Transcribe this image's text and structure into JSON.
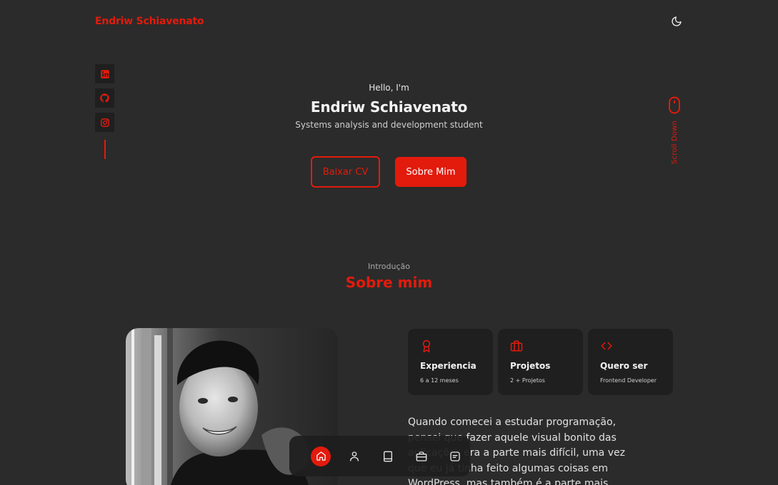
{
  "header": {
    "brand": "Endriw Schiavenato",
    "theme_icon": "moon-icon"
  },
  "social": {
    "items": [
      {
        "icon": "linkedin-icon"
      },
      {
        "icon": "github-icon"
      },
      {
        "icon": "instagram-icon"
      }
    ]
  },
  "hero": {
    "greeting": "Hello, I'm",
    "name": "Endriw Schiavenato",
    "subtitle": "Systems analysis and development student",
    "download_cv_label": "Baixar CV",
    "about_me_label": "Sobre Mim"
  },
  "scroll": {
    "label": "Scroll Down",
    "icon": "mouse-icon"
  },
  "about": {
    "subtitle": "Introdução",
    "title": "Sobre mim",
    "cards": [
      {
        "icon": "award-icon",
        "title": "Experiencia",
        "subtitle": "6 a 12 meses"
      },
      {
        "icon": "briefcase-icon",
        "title": "Projetos",
        "subtitle": "2 + Projetos"
      },
      {
        "icon": "code-icon",
        "title": "Quero ser",
        "subtitle": "Frontend Developer"
      }
    ],
    "text": "Quando comecei a estudar programação, pensei que fazer aquele visual bonito das aplicações era a parte mais difícil, uma vez que eu já tinha feito algumas coisas em WordPress, mas também é a parte mais prazerosa e que"
  },
  "bottom_nav": {
    "items": [
      {
        "icon": "home-icon",
        "active": true
      },
      {
        "icon": "user-icon",
        "active": false
      },
      {
        "icon": "book-icon",
        "active": false
      },
      {
        "icon": "briefcase-icon",
        "active": false
      },
      {
        "icon": "message-icon",
        "active": false
      }
    ]
  },
  "colors": {
    "accent": "#e21b0c",
    "background": "#2b2b2b",
    "card": "#1f1f1f"
  }
}
